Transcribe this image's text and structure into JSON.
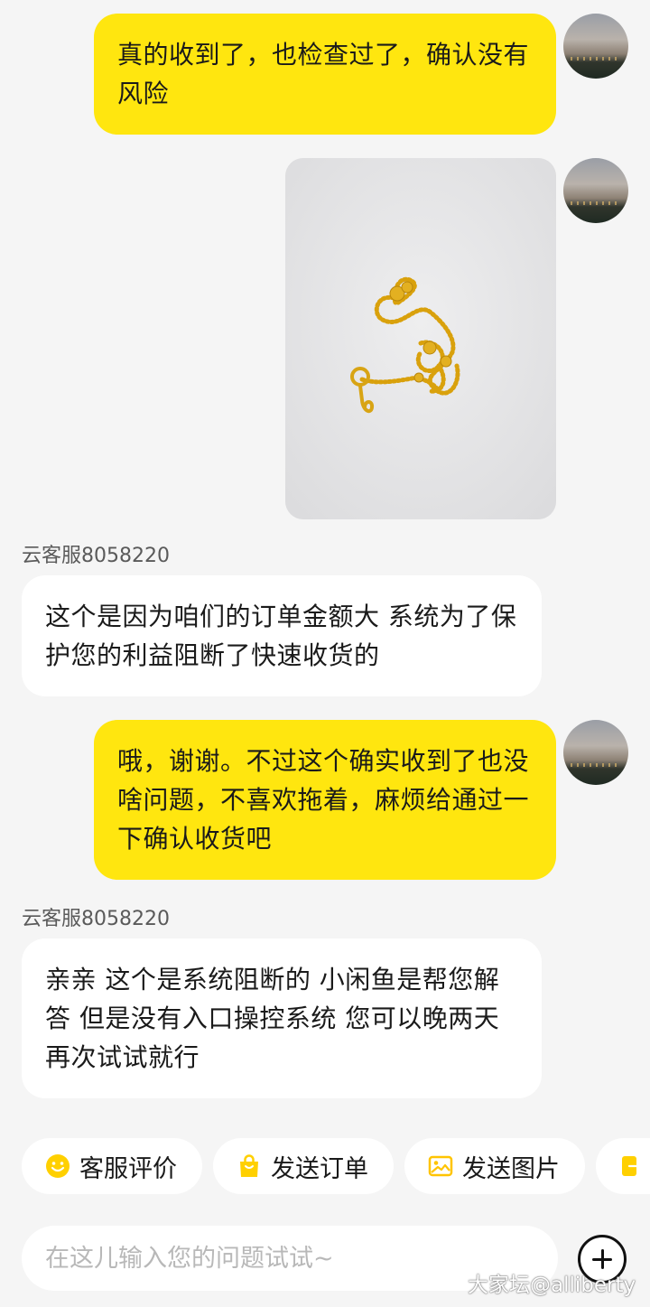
{
  "messages": [
    {
      "from": "me",
      "text": "真的收到了，也检查过了，确认没有风险"
    },
    {
      "from": "me",
      "type": "image"
    },
    {
      "from": "them",
      "sender": "云客服8058220",
      "text": "这个是因为咱们的订单金额大 系统为了保护您的利益阻断了快速收货的"
    },
    {
      "from": "me",
      "text": "哦，谢谢。不过这个确实收到了也没啥问题，不喜欢拖着，麻烦给通过一下确认收货吧"
    },
    {
      "from": "them",
      "sender": "云客服8058220",
      "text": "亲亲 这个是系统阻断的 小闲鱼是帮您解答 但是没有入口操控系统 您可以晚两天再次试试就行"
    }
  ],
  "quick_actions": [
    {
      "label": "客服评价",
      "icon": "smile-icon"
    },
    {
      "label": "发送订单",
      "icon": "shopping-bag-icon"
    },
    {
      "label": "发送图片",
      "icon": "image-icon"
    },
    {
      "label": "",
      "icon": "exit-icon"
    }
  ],
  "composer": {
    "placeholder": "在这儿输入您的问题试试~",
    "plus_icon": "plus-circle-icon"
  },
  "watermark": "大家坛@alliberty",
  "colors": {
    "my_bubble": "#ffe60f",
    "their_bubble": "#ffffff",
    "background": "#f5f5f5",
    "accent": "#ffd000"
  }
}
